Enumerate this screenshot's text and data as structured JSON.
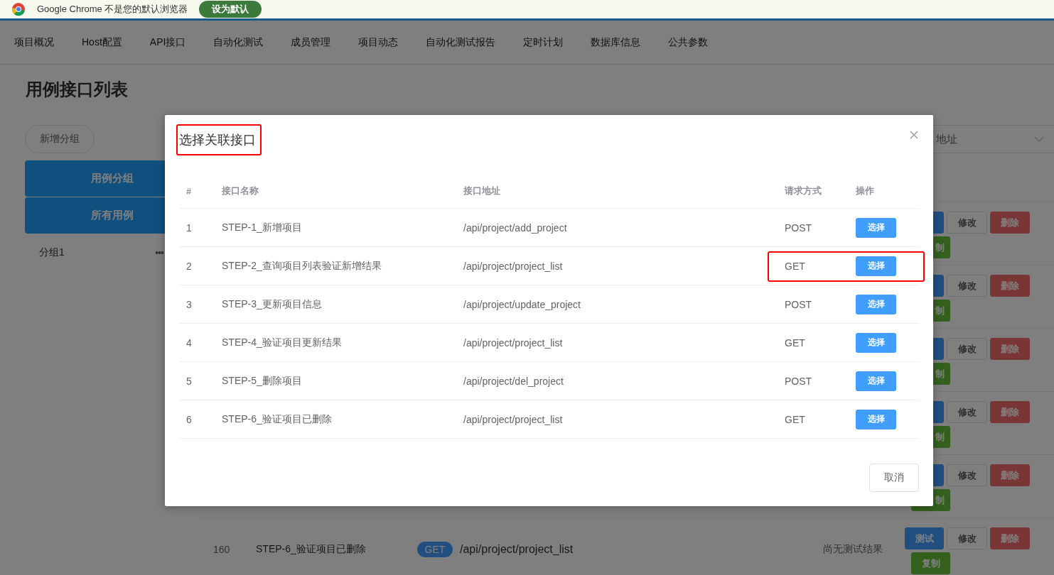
{
  "browser_infobar": {
    "message": "Google Chrome 不是您的默认浏览器",
    "button": "设为默认"
  },
  "nav": {
    "items": [
      "项目概况",
      "Host配置",
      "API接口",
      "自动化测试",
      "成员管理",
      "项目动态",
      "自动化测试报告",
      "定时计划",
      "数据库信息",
      "公共参数"
    ]
  },
  "page": {
    "title": "用例接口列表",
    "add_group_button": "新增分组",
    "group_tabs": [
      "用例分组",
      "所有用例"
    ],
    "groups": [
      {
        "name": "分组1",
        "menu": "•••"
      }
    ],
    "search_select": {
      "value": "地址"
    },
    "rows": [
      {
        "actions": [
          {
            "kind": "test"
          },
          {
            "kind": "edit",
            "label": "修改"
          },
          {
            "kind": "delete",
            "label": "删除"
          },
          {
            "kind": "copy",
            "label": "制"
          }
        ]
      },
      {
        "actions": [
          {
            "kind": "test"
          },
          {
            "kind": "edit",
            "label": "修改"
          },
          {
            "kind": "delete",
            "label": "删除"
          },
          {
            "kind": "copy",
            "label": "制"
          }
        ]
      },
      {
        "actions": [
          {
            "kind": "test"
          },
          {
            "kind": "edit",
            "label": "修改"
          },
          {
            "kind": "delete",
            "label": "删除"
          },
          {
            "kind": "copy",
            "label": "制"
          }
        ]
      },
      {
        "actions": [
          {
            "kind": "test"
          },
          {
            "kind": "edit",
            "label": "修改"
          },
          {
            "kind": "delete",
            "label": "删除"
          },
          {
            "kind": "copy",
            "label": "制"
          }
        ]
      },
      {
        "actions": [
          {
            "kind": "test"
          },
          {
            "kind": "edit",
            "label": "修改"
          },
          {
            "kind": "delete",
            "label": "删除"
          },
          {
            "kind": "copy",
            "label": "制"
          }
        ]
      },
      {
        "index": "160",
        "name": "STEP-6_验证项目已删除",
        "method": "GET",
        "path": "/api/project/project_list",
        "result": "尚无测试结果",
        "actions": [
          {
            "kind": "test",
            "label": "测试"
          },
          {
            "kind": "edit",
            "label": "修改"
          },
          {
            "kind": "delete",
            "label": "删除"
          },
          {
            "kind": "copy",
            "label": "复制"
          }
        ]
      }
    ]
  },
  "dialog": {
    "title": "选择关联接口",
    "title_highlighted": true,
    "columns": [
      "#",
      "接口名称",
      "接口地址",
      "请求方式",
      "操作"
    ],
    "rows": [
      {
        "index": "1",
        "name": "STEP-1_新增项目",
        "path": "/api/project/add_project",
        "method": "POST",
        "action": "选择",
        "highlighted": false
      },
      {
        "index": "2",
        "name": "STEP-2_查询项目列表验证新增结果",
        "path": "/api/project/project_list",
        "method": "GET",
        "action": "选择",
        "highlighted": true
      },
      {
        "index": "3",
        "name": "STEP-3_更新项目信息",
        "path": "/api/project/update_project",
        "method": "POST",
        "action": "选择",
        "highlighted": false
      },
      {
        "index": "4",
        "name": "STEP-4_验证项目更新结果",
        "path": "/api/project/project_list",
        "method": "GET",
        "action": "选择",
        "highlighted": false
      },
      {
        "index": "5",
        "name": "STEP-5_删除项目",
        "path": "/api/project/del_project",
        "method": "POST",
        "action": "选择",
        "highlighted": false
      },
      {
        "index": "6",
        "name": "STEP-6_验证项目已删除",
        "path": "/api/project/project_list",
        "method": "GET",
        "action": "选择",
        "highlighted": false
      }
    ],
    "cancel_button": "取消"
  }
}
